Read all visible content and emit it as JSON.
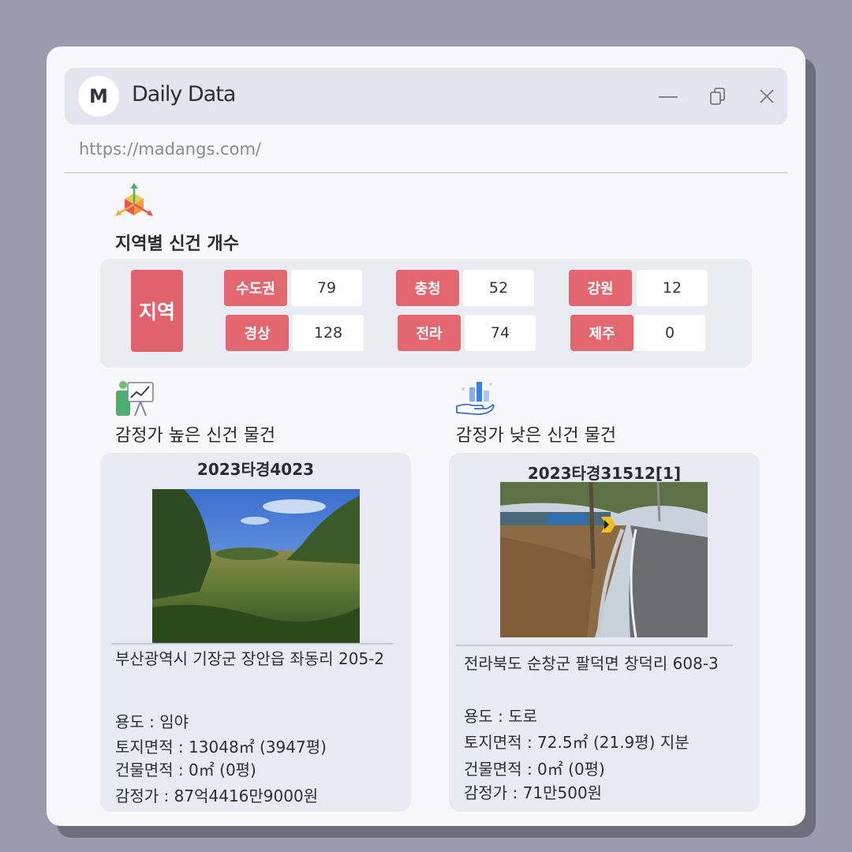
{
  "window": {
    "logo_letter": "M",
    "title": "Daily Data",
    "url": "https://madangs.com/"
  },
  "icons": {
    "minimize": "minimize-icon",
    "restore": "restore-icon",
    "close": "close-icon",
    "regions": "3d-axes-icon",
    "high": "presentation-chart-icon",
    "low": "hand-chart-icon"
  },
  "regions": {
    "title": "지역별 신건 개수",
    "label": "지역",
    "items": [
      {
        "name": "수도권",
        "count": "79"
      },
      {
        "name": "충청",
        "count": "52"
      },
      {
        "name": "강원",
        "count": "12"
      },
      {
        "name": "경상",
        "count": "128"
      },
      {
        "name": "전라",
        "count": "74"
      },
      {
        "name": "제주",
        "count": "0"
      }
    ]
  },
  "high": {
    "title": "감정가 높은 신건 물건",
    "case_no": "2023타경4023",
    "address": "부산광역시 기장군 장안읍 좌동리 205-2",
    "usage": "용도 : 임야",
    "land_area": "토지면적 : 13048㎡ (3947평)",
    "building_area": "건물면적 : 0㎡ (0평)",
    "price": "감정가 : 87억4416만9000원"
  },
  "low": {
    "title": "감정가 낮은 신건 물건",
    "case_no": "2023타경31512[1]",
    "address": "전라북도 순창군 팔덕면 창덕리 608-3",
    "usage": "용도 :  도로",
    "land_area": "토지면적 : 72.5㎡ (21.9평) 지분",
    "building_area": "건물면적 : 0㎡ (0평)",
    "price": "감정가 : 71만500원"
  },
  "colors": {
    "accent": "#e2676f",
    "panel": "#ebebf4",
    "background": "#9a9cad"
  }
}
